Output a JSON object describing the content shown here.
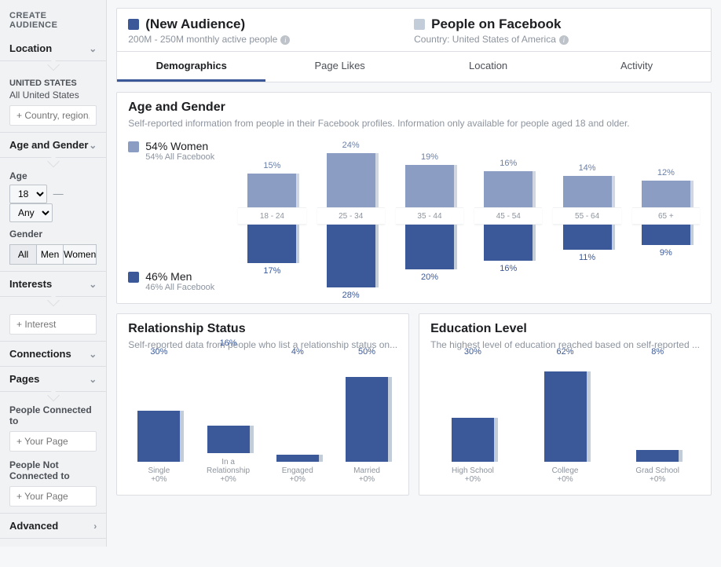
{
  "sidebar": {
    "title": "CREATE AUDIENCE",
    "location": {
      "label": "Location",
      "region_label": "UNITED STATES",
      "region_value": "All United States",
      "placeholder": "+ Country, region, or city"
    },
    "age_gender": {
      "label": "Age and Gender",
      "age_label": "Age",
      "age_from": "18",
      "age_to": "Any",
      "gender_label": "Gender",
      "options": [
        "All",
        "Men",
        "Women"
      ]
    },
    "interests": {
      "label": "Interests",
      "placeholder": "+ Interest"
    },
    "connections": {
      "label": "Connections"
    },
    "pages": {
      "label": "Pages",
      "connected_label": "People Connected to",
      "not_connected_label": "People Not Connected to",
      "placeholder": "+ Your Page"
    },
    "advanced": {
      "label": "Advanced"
    }
  },
  "header": {
    "new_audience": {
      "title": "(New Audience)",
      "subtitle": "200M - 250M monthly active people"
    },
    "people": {
      "title": "People on Facebook",
      "subtitle": "Country: United States of America"
    },
    "tabs": [
      "Demographics",
      "Page Likes",
      "Location",
      "Activity"
    ]
  },
  "age_gender_card": {
    "title": "Age and Gender",
    "subtitle": "Self-reported information from people in their Facebook profiles. Information only available for people aged 18 and older.",
    "women": {
      "pct": "54% Women",
      "sub": "54% All Facebook"
    },
    "men": {
      "pct": "46% Men",
      "sub": "46% All Facebook"
    }
  },
  "relationship": {
    "title": "Relationship Status",
    "subtitle": "Self-reported data from people who list a relationship status on..."
  },
  "education": {
    "title": "Education Level",
    "subtitle": "The highest level of education reached based on self-reported ..."
  },
  "chart_data": {
    "age_gender": {
      "type": "bar",
      "categories": [
        "18 - 24",
        "25 - 34",
        "35 - 44",
        "45 - 54",
        "55 - 64",
        "65 +"
      ],
      "series": [
        {
          "name": "Women",
          "values": [
            15,
            24,
            19,
            16,
            14,
            12
          ]
        },
        {
          "name": "Men",
          "values": [
            17,
            28,
            20,
            16,
            11,
            9
          ]
        }
      ],
      "unit": "%",
      "ylim": [
        0,
        30
      ]
    },
    "relationship": {
      "type": "bar",
      "categories": [
        "Single",
        "In a Relationship",
        "Engaged",
        "Married"
      ],
      "values": [
        30,
        16,
        4,
        50
      ],
      "diff": [
        "+0%",
        "+0%",
        "+0%",
        "+0%"
      ],
      "unit": "%",
      "ylim": [
        0,
        60
      ]
    },
    "education": {
      "type": "bar",
      "categories": [
        "High School",
        "College",
        "Grad School"
      ],
      "values": [
        30,
        62,
        8
      ],
      "diff": [
        "+0%",
        "+0%",
        "+0%"
      ],
      "unit": "%",
      "ylim": [
        0,
        70
      ]
    }
  }
}
